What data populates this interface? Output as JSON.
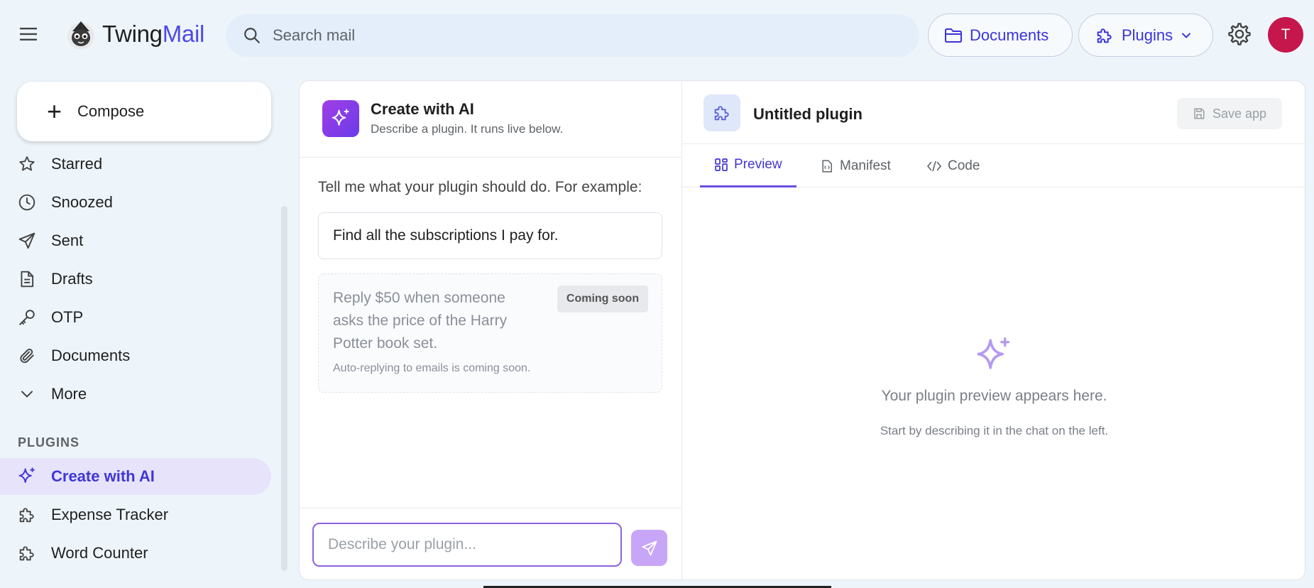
{
  "header": {
    "logo_part1": "Twing",
    "logo_part2": "Mail",
    "search_placeholder": "Search mail",
    "documents_label": "Documents",
    "plugins_label": "Plugins",
    "avatar_initial": "T"
  },
  "sidebar": {
    "compose_label": "Compose",
    "items": [
      {
        "label": "Starred",
        "icon": "star-icon"
      },
      {
        "label": "Snoozed",
        "icon": "clock-icon"
      },
      {
        "label": "Sent",
        "icon": "send-icon"
      },
      {
        "label": "Drafts",
        "icon": "draft-icon"
      },
      {
        "label": "OTP",
        "icon": "key-icon"
      },
      {
        "label": "Documents",
        "icon": "paperclip-icon"
      },
      {
        "label": "More",
        "icon": "chevron-down-icon"
      }
    ],
    "plugins_heading": "PLUGINS",
    "plugins": [
      {
        "label": "Create with AI",
        "icon": "sparkle-icon",
        "active": true
      },
      {
        "label": "Expense Tracker",
        "icon": "puzzle-icon"
      },
      {
        "label": "Word Counter",
        "icon": "puzzle-icon"
      }
    ]
  },
  "chat": {
    "title": "Create with AI",
    "subtitle": "Describe a plugin. It runs live below.",
    "intro": "Tell me what your plugin should do. For example:",
    "suggestion": "Find all the subscriptions I pay for.",
    "coming_soon_text": "Reply $50 when someone asks the price of the Harry Potter book set.",
    "coming_soon_badge": "Coming soon",
    "coming_soon_note": "Auto-replying to emails is coming soon.",
    "input_placeholder": "Describe your plugin..."
  },
  "preview": {
    "title": "Untitled plugin",
    "save_label": "Save app",
    "tabs": [
      {
        "label": "Preview",
        "icon": "grid-icon",
        "active": true
      },
      {
        "label": "Manifest",
        "icon": "file-icon"
      },
      {
        "label": "Code",
        "icon": "code-icon"
      }
    ],
    "empty_title": "Your plugin preview appears here.",
    "empty_subtitle": "Start by describing it in the chat on the left."
  },
  "colors": {
    "accent": "#4136d6",
    "active_bg": "#e6e3fb",
    "avatar": "#c5174c",
    "page_bg": "#eef5fa"
  }
}
